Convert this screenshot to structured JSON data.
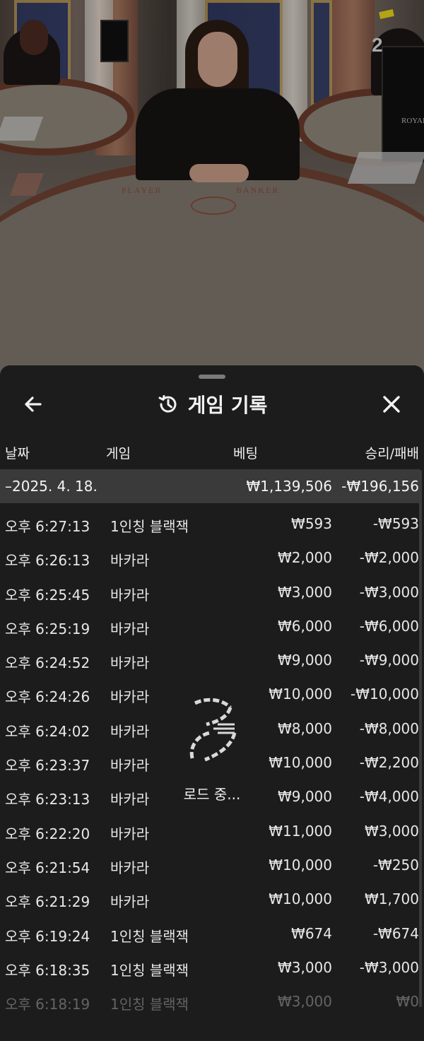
{
  "scene": {
    "round_number": "2",
    "table_left_label": "PLAYER",
    "table_right_label": "BANKER",
    "brand_sign": "ROYAL"
  },
  "sheet": {
    "title": "게임 기록",
    "columns": {
      "date": "날짜",
      "game": "게임",
      "bet": "베팅",
      "result": "승리/패배"
    },
    "date_group": {
      "label": "–2025. 4. 18.",
      "bet_total": "₩1,139,506",
      "result_total": "-₩196,156"
    },
    "rows": [
      {
        "time": "오후 6:27:13",
        "game": "1인칭 블랙잭",
        "bet": "₩593",
        "result": "-₩593"
      },
      {
        "time": "오후 6:26:13",
        "game": "바카라",
        "bet": "₩2,000",
        "result": "-₩2,000"
      },
      {
        "time": "오후 6:25:45",
        "game": "바카라",
        "bet": "₩3,000",
        "result": "-₩3,000"
      },
      {
        "time": "오후 6:25:19",
        "game": "바카라",
        "bet": "₩6,000",
        "result": "-₩6,000"
      },
      {
        "time": "오후 6:24:52",
        "game": "바카라",
        "bet": "₩9,000",
        "result": "-₩9,000"
      },
      {
        "time": "오후 6:24:26",
        "game": "바카라",
        "bet": "₩10,000",
        "result": "-₩10,000"
      },
      {
        "time": "오후 6:24:02",
        "game": "바카라",
        "bet": "₩8,000",
        "result": "-₩8,000"
      },
      {
        "time": "오후 6:23:37",
        "game": "바카라",
        "bet": "₩10,000",
        "result": "-₩2,200"
      },
      {
        "time": "오후 6:23:13",
        "game": "바카라",
        "bet": "₩9,000",
        "result": "-₩4,000"
      },
      {
        "time": "오후 6:22:20",
        "game": "바카라",
        "bet": "₩11,000",
        "result": "₩3,000"
      },
      {
        "time": "오후 6:21:54",
        "game": "바카라",
        "bet": "₩10,000",
        "result": "-₩250"
      },
      {
        "time": "오후 6:21:29",
        "game": "바카라",
        "bet": "₩10,000",
        "result": "₩1,700"
      },
      {
        "time": "오후 6:19:24",
        "game": "1인칭 블랙잭",
        "bet": "₩674",
        "result": "-₩674"
      },
      {
        "time": "오후 6:18:35",
        "game": "1인칭 블랙잭",
        "bet": "₩3,000",
        "result": "-₩3,000"
      },
      {
        "time": "오후 6:18:19",
        "game": "1인칭 블랙잭",
        "bet": "₩3,000",
        "result": "₩0"
      }
    ],
    "loading_text": "로드 중...",
    "icons": {
      "back": "arrow-left-icon",
      "history": "history-clock-icon",
      "close": "close-x-icon",
      "loader": "brand-spinner-icon"
    }
  }
}
